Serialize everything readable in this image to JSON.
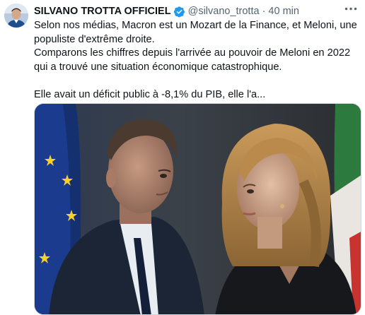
{
  "post": {
    "author_name": "SILVANO TROTTA OFFICIEL",
    "handle": "@silvano_trotta",
    "separator": "·",
    "time": "40 min",
    "text_lines": [
      "Selon nos médias, Macron est un Mozart de la Finance, et Meloni, une populiste d'extrême droite.",
      "Comparons les chiffres depuis l'arrivée au pouvoir de Meloni en 2022 qui a trouvé une situation économique catastrophique.",
      "Elle avait un déficit public à -8,1% du PIB, elle l'a..."
    ],
    "verified_color": "#1d9bf0",
    "icons": [
      "avatar",
      "verified-badge-icon",
      "more-options-icon"
    ]
  }
}
